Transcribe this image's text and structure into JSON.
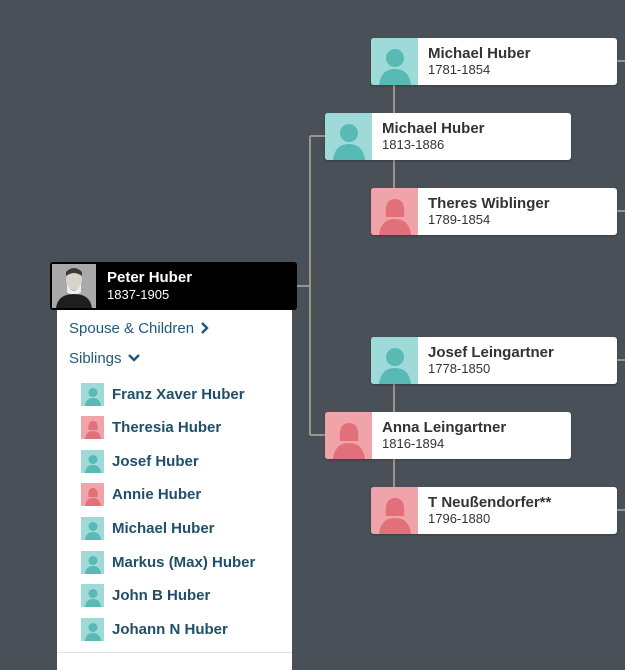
{
  "focus_person": {
    "name": "Peter Huber",
    "dates": "1837-1905"
  },
  "menu": {
    "spouse_children": "Spouse & Children",
    "siblings": "Siblings"
  },
  "siblings": [
    {
      "name": "Franz Xaver Huber",
      "gender": "male"
    },
    {
      "name": "Theresia Huber",
      "gender": "female"
    },
    {
      "name": "Josef Huber",
      "gender": "male"
    },
    {
      "name": "Annie Huber",
      "gender": "female"
    },
    {
      "name": "Michael Huber",
      "gender": "male"
    },
    {
      "name": "Markus (Max) Huber",
      "gender": "male"
    },
    {
      "name": "John B Huber",
      "gender": "male"
    },
    {
      "name": "Johann N Huber",
      "gender": "male"
    }
  ],
  "tree": {
    "father": {
      "name": "Michael Huber",
      "dates": "1813-1886",
      "gender": "male"
    },
    "mother": {
      "name": "Anna Leingartner",
      "dates": "1816-1894",
      "gender": "female"
    },
    "paternal_grandfather": {
      "name": "Michael Huber",
      "dates": "1781-1854",
      "gender": "male"
    },
    "paternal_grandmother": {
      "name": "Theres Wiblinger",
      "dates": "1789-1854",
      "gender": "female"
    },
    "maternal_grandfather": {
      "name": "Josef Leingartner",
      "dates": "1778-1850",
      "gender": "male"
    },
    "maternal_grandmother": {
      "name": "T Neußendorfer**",
      "dates": "1796-1880",
      "gender": "female"
    }
  },
  "colors": {
    "background": "#4a5058",
    "male": "#9edad8",
    "female": "#f1a3aa",
    "silhouette_male": "#58b9b5",
    "silhouette_female": "#e2707a",
    "link": "#1f5a7a",
    "connector": "#9b9587"
  }
}
